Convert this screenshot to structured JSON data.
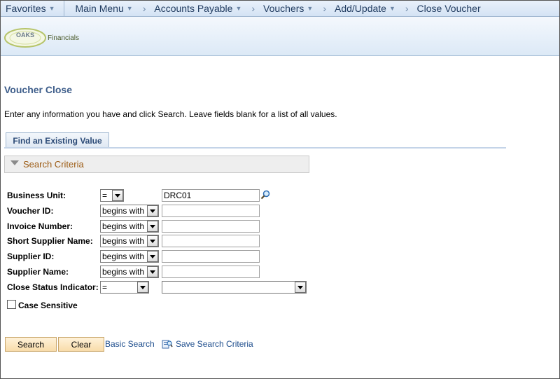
{
  "nav": {
    "favorites": "Favorites",
    "main_menu": "Main Menu",
    "accounts_payable": "Accounts Payable",
    "vouchers": "Vouchers",
    "add_update": "Add/Update",
    "close_voucher": "Close Voucher"
  },
  "banner": {
    "logo_oaks": "OAKS",
    "logo_financials": "Financials"
  },
  "page": {
    "title": "Voucher Close",
    "instructions": "Enter any information you have and click Search. Leave fields blank for a list of all values.",
    "tab_label": "Find an Existing Value",
    "criteria_label": "Search Criteria"
  },
  "fields": [
    {
      "label": "Business Unit:",
      "operator": "=",
      "value": ""
    },
    {
      "label": "Voucher ID:",
      "operator": "begins with",
      "value": ""
    },
    {
      "label": "Invoice Number:",
      "operator": "begins with",
      "value": ""
    },
    {
      "label": "Short Supplier Name:",
      "operator": "begins with",
      "value": ""
    },
    {
      "label": "Supplier ID:",
      "operator": "begins with",
      "value": ""
    },
    {
      "label": "Supplier Name:",
      "operator": "begins with",
      "value": ""
    },
    {
      "label": "Close Status Indicator:",
      "operator": "=",
      "value": ""
    }
  ],
  "business_unit_value": "DRC01",
  "case_sensitive_label": "Case Sensitive",
  "buttons": {
    "search": "Search",
    "clear": "Clear",
    "basic_search": "Basic Search",
    "save_search": "Save Search Criteria"
  },
  "colors": {
    "title": "#3d5d8a",
    "criteria": "#9c5b13",
    "link": "#1c4c8c",
    "button_bg": "#f8dcaa"
  },
  "icons": [
    "chevron-down-icon",
    "magnifier-icon",
    "save-search-icon",
    "oaks-logo"
  ]
}
